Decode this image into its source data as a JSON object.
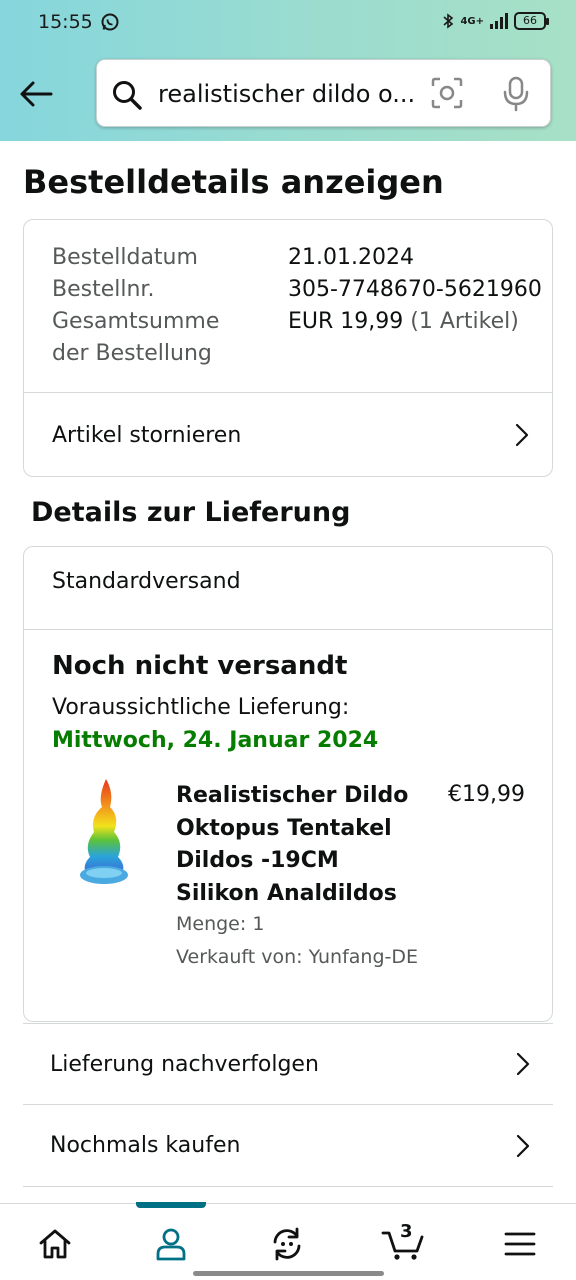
{
  "status_bar": {
    "time": "15:55",
    "network": "4G+",
    "battery": "66"
  },
  "search": {
    "query": "realistischer dildo o..."
  },
  "page": {
    "title": "Bestelldetails anzeigen"
  },
  "order_summary": {
    "date_label": "Bestelldatum",
    "date_value": "21.01.2024",
    "number_label": "Bestellnr.",
    "number_value": "305-7748670-5621960",
    "total_label_line1": "Gesamtsumme",
    "total_label_line2": "der Bestellung",
    "total_value": "EUR 19,99",
    "total_items": "(1 Artikel)",
    "cancel_label": "Artikel stornieren"
  },
  "delivery": {
    "section_title": "Details zur Lieferung",
    "shipping_type": "Standardversand",
    "status": "Noch nicht versandt",
    "expected_label": "Voraussichtliche Lieferung:",
    "expected_date": "Mittwoch, 24. Januar 2024",
    "product": {
      "title": "Realistischer Dildo Oktopus Tentakel Dildos -19CM Silikon Analdildos",
      "price": "€19,99",
      "quantity": "Menge: 1",
      "seller": "Verkauft von: Yunfang-DE"
    }
  },
  "actions": {
    "track": "Lieferung nachverfolgen",
    "buy_again": "Nochmals kaufen"
  },
  "bottom_nav": {
    "cart_count": "3",
    "active": "account",
    "accent_color": "#007185"
  },
  "colors": {
    "delivery_date": "#067d00",
    "header_gradient_start": "#86d6dd",
    "header_gradient_end": "#a7e0c6"
  }
}
